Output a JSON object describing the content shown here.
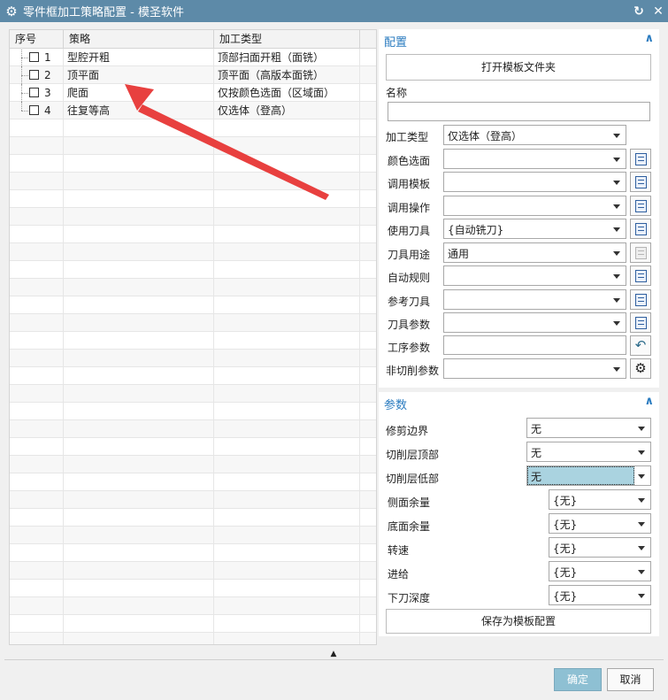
{
  "window": {
    "title": "零件框加工策略配置 - 模圣软件"
  },
  "tree": {
    "columns": [
      "序号",
      "策略",
      "加工类型"
    ],
    "rows": [
      {
        "index": "1",
        "strategy": "型腔开粗",
        "type": "顶部扫面开粗（面铣）"
      },
      {
        "index": "2",
        "strategy": "顶平面",
        "type": "顶平面（高版本面铣）"
      },
      {
        "index": "3",
        "strategy": "爬面",
        "type": "仅按颜色选面（区域面）"
      },
      {
        "index": "4",
        "strategy": "往复等高",
        "type": "仅选体（登高）"
      }
    ]
  },
  "config": {
    "header": "配置",
    "open_template_folder": "打开模板文件夹",
    "name_label": "名称",
    "name_value": "",
    "fields": [
      {
        "label": "加工类型",
        "value": "仅选体（登高）"
      },
      {
        "label": "颜色选面",
        "value": ""
      },
      {
        "label": "调用模板",
        "value": ""
      },
      {
        "label": "调用操作",
        "value": ""
      },
      {
        "label": "使用刀具",
        "value": "{自动铣刀}"
      },
      {
        "label": "刀具用途",
        "value": "通用"
      },
      {
        "label": "自动规则",
        "value": ""
      },
      {
        "label": "参考刀具",
        "value": ""
      },
      {
        "label": "刀具参数",
        "value": ""
      },
      {
        "label": "工序参数",
        "value": ""
      },
      {
        "label": "非切削参数",
        "value": ""
      }
    ]
  },
  "params": {
    "header": "参数",
    "fields": [
      {
        "label": "修剪边界",
        "value": "无"
      },
      {
        "label": "切削层顶部",
        "value": "无"
      },
      {
        "label": "切削层低部",
        "value": "无"
      },
      {
        "label": "侧面余量",
        "value": "{无}"
      },
      {
        "label": "底面余量",
        "value": "{无}"
      },
      {
        "label": "转速",
        "value": "{无}"
      },
      {
        "label": "进给",
        "value": "{无}"
      },
      {
        "label": "下刀深度",
        "value": "{无}"
      }
    ],
    "save_button": "保存为模板配置"
  },
  "footer": {
    "ok": "确定",
    "cancel": "取消"
  },
  "colors": {
    "title_bar": "#5d8aa8",
    "accent": "#2b7cc0",
    "ok_button": "#8ec0d3",
    "selected_combo": "#aad3e0",
    "arrow": "#e8403f"
  }
}
